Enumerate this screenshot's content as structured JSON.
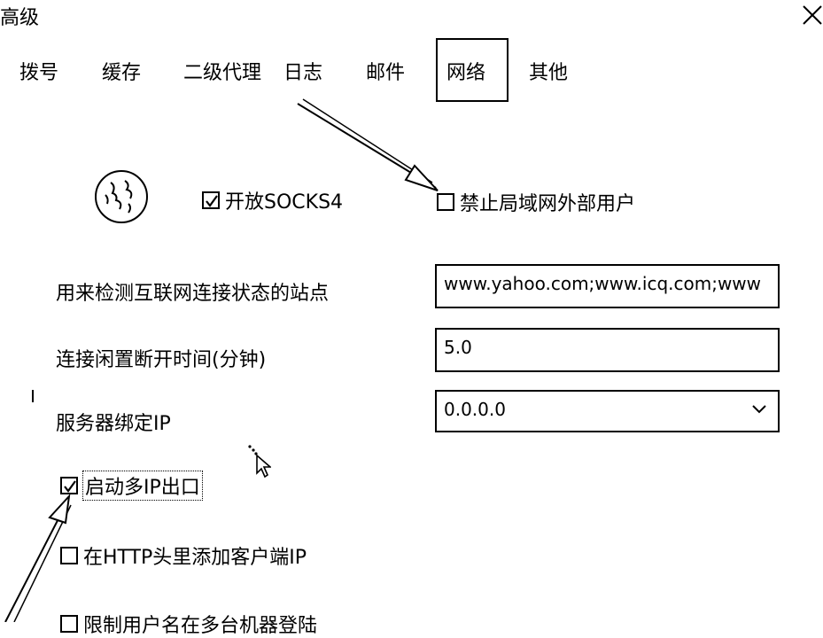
{
  "window": {
    "title": "高级"
  },
  "tabs": [
    {
      "label": "拨号"
    },
    {
      "label": "缓存"
    },
    {
      "label": "二级代理"
    },
    {
      "label": "日志"
    },
    {
      "label": "邮件"
    },
    {
      "label": "网络"
    },
    {
      "label": "其他"
    }
  ],
  "selected_tab": "网络",
  "options": {
    "socks4": {
      "label": "开放SOCKS4",
      "checked": true
    },
    "block_lan_external": {
      "label": "禁止局域网外部用户",
      "checked": false
    },
    "multi_ip": {
      "label": "启动多IP出口",
      "checked": true
    },
    "http_client_ip": {
      "label": "在HTTP头里添加客户端IP",
      "checked": false
    },
    "limit_user_login": {
      "label": "限制用户名在多台机器登陆",
      "checked": false
    }
  },
  "fields": {
    "check_sites": {
      "label": "用来检测互联网连接状态的站点",
      "value": "www.yahoo.com;www.icq.com;www"
    },
    "idle_timeout": {
      "label": "连接闲置断开时间(分钟)",
      "value": "5.0"
    },
    "bind_ip": {
      "label": "服务器绑定IP",
      "value": "0.0.0.0"
    }
  }
}
